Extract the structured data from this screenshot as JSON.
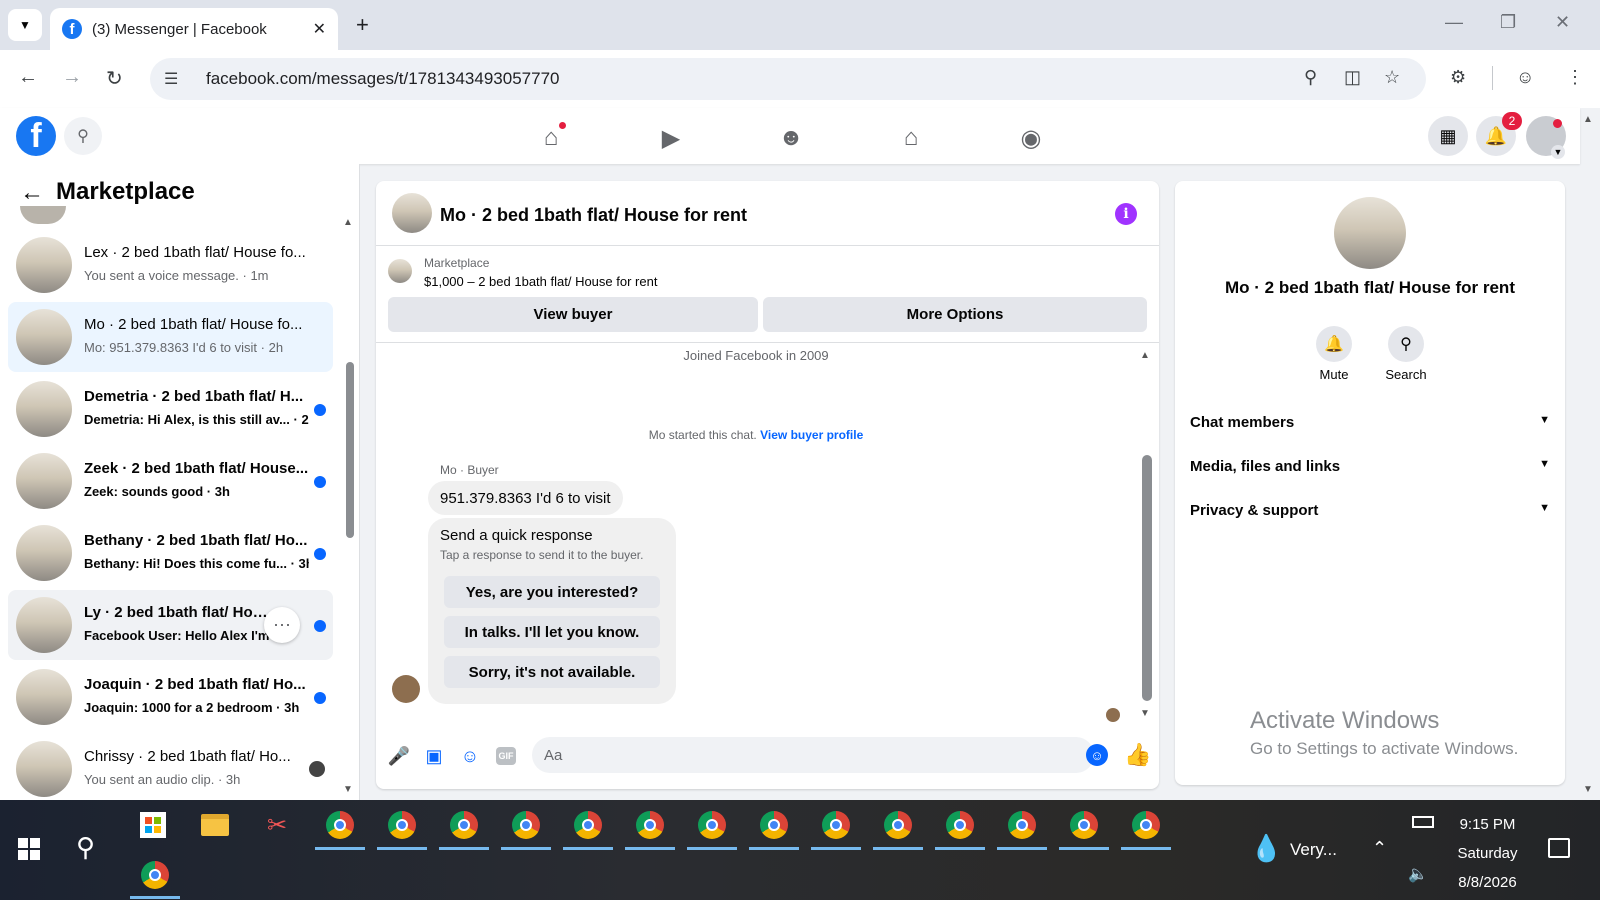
{
  "browser": {
    "tab_title": "(3) Messenger | Facebook",
    "url": "facebook.com/messages/t/1781343493057770"
  },
  "fb_header": {
    "notification_count": "2",
    "nav_icons": [
      "home-icon",
      "video-icon",
      "friends-icon",
      "marketplace-icon",
      "gaming-icon"
    ]
  },
  "sidebar": {
    "title": "Marketplace",
    "conversations": [
      {
        "name": "Lex · 2 bed 1bath flat/ House fo...",
        "preview": "You sent a voice message. · 1m",
        "unread": false
      },
      {
        "name": "Mo · 2 bed 1bath flat/ House fo...",
        "preview": "Mo: 951.379.8363 I'd 6 to visit · 2h",
        "unread": false,
        "selected": true
      },
      {
        "name": "Demetria · 2 bed 1bath flat/ H...",
        "preview": "Demetria: Hi Alex, is this still av... · 2h",
        "unread": true
      },
      {
        "name": "Zeek · 2 bed 1bath flat/ House...",
        "preview": "Zeek: sounds good · 3h",
        "unread": true
      },
      {
        "name": "Bethany · 2 bed 1bath flat/ Ho...",
        "preview": "Bethany: Hi! Does this come fu... · 3h",
        "unread": true
      },
      {
        "name": "Ly · 2 bed 1bath flat/ House f...",
        "preview": "Facebook User: Hello Alex I'm l...",
        "unread": true
      },
      {
        "name": "Joaquin · 2 bed 1bath flat/ Ho...",
        "preview": "Joaquin: 1000 for a 2 bedroom · 3h",
        "unread": true
      },
      {
        "name": "Chrissy · 2 bed 1bath flat/ Ho...",
        "preview": "You sent an audio clip. · 3h",
        "unread": false
      }
    ]
  },
  "chat": {
    "title": "Mo · 2 bed 1bath flat/ House for rent",
    "marketplace_label": "Marketplace",
    "listing": "$1,000 – 2 bed 1bath flat/ House for rent",
    "view_buyer": "View buyer",
    "more_options": "More Options",
    "joined": "Joined Facebook in 2009",
    "started": "Mo started this chat.",
    "view_profile": "View buyer profile",
    "sender_label": "Mo · Buyer",
    "message": "951.379.8363 I'd 6 to visit",
    "quick_title": "Send a quick response",
    "quick_sub": "Tap a response to send it to the buyer.",
    "quick_responses": [
      "Yes, are you interested?",
      "In talks. I'll let you know.",
      "Sorry, it's not available."
    ],
    "composer_placeholder": "Aa"
  },
  "details": {
    "name": "Mo · 2 bed 1bath flat/ House for rent",
    "mute": "Mute",
    "search": "Search",
    "sections": [
      "Chat members",
      "Media, files and links",
      "Privacy & support"
    ]
  },
  "watermark": {
    "line1": "Activate Windows",
    "line2": "Go to Settings to activate Windows."
  },
  "taskbar": {
    "weather": "Very...",
    "time": "9:15 PM",
    "day": "Saturday",
    "date": "8/8/2026"
  }
}
